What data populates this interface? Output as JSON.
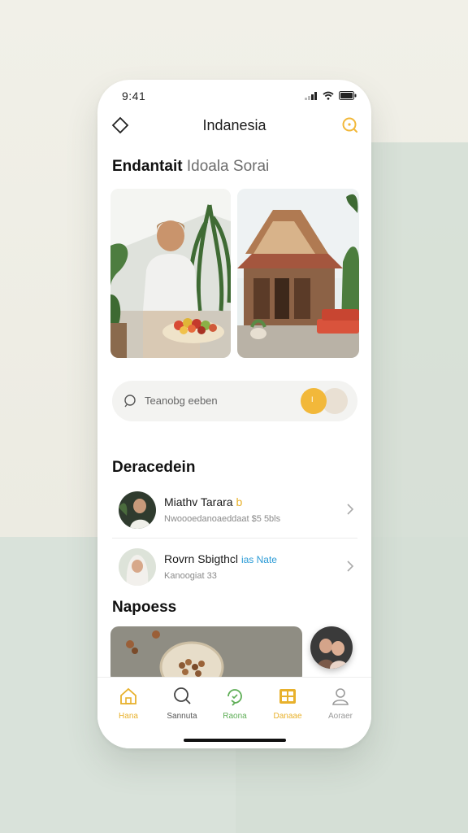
{
  "status_bar": {
    "time": "9:41"
  },
  "header": {
    "title": "Indanesia"
  },
  "section_title": {
    "bold": "Endantait",
    "light": "Idoala Sorai"
  },
  "search": {
    "placeholder": "Teanobg eeben"
  },
  "toggle": {
    "label": "I"
  },
  "section2": {
    "title": "Deracedein"
  },
  "list": [
    {
      "title": "Miathv Tarara",
      "title_accent": "b",
      "subtitle": "Nwoooedanoaeddaat $5 5bls"
    },
    {
      "title": "Rovrn Sbigthcl",
      "title_accent": "ias Nate",
      "subtitle": "Kanoogiat 33"
    }
  ],
  "section3": {
    "title": "Napoess"
  },
  "tabs": [
    {
      "label": "Hana",
      "icon": "home-icon",
      "color": "#e8b12c"
    },
    {
      "label": "Sannuta",
      "icon": "search-icon",
      "color": "#555555"
    },
    {
      "label": "Raona",
      "icon": "refresh-icon",
      "color": "#5fae57"
    },
    {
      "label": "Danaae",
      "icon": "grid-icon",
      "color": "#e8b12c"
    },
    {
      "label": "Aoraer",
      "icon": "person-icon",
      "color": "#9a9a9a"
    }
  ],
  "colors": {
    "accent": "#f2b83a",
    "green": "#5fae57",
    "blue": "#2b9bd6"
  }
}
